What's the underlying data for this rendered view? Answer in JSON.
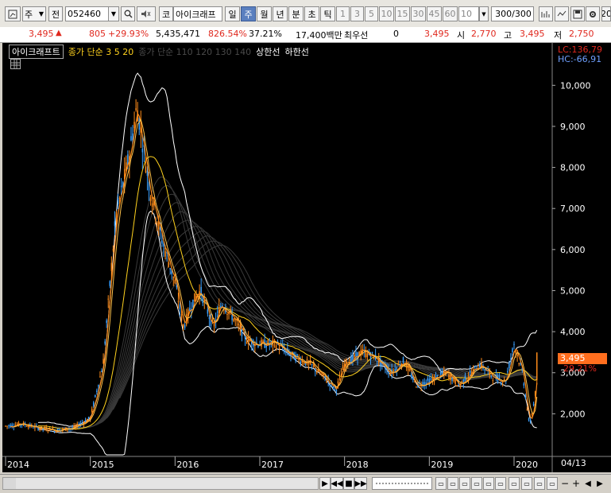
{
  "toolbar": {
    "market": "주",
    "type_label": "전",
    "code": "052460",
    "item_marker": "코",
    "item_name": "아이크래프",
    "period_tabs": [
      "일",
      "주",
      "월",
      "년"
    ],
    "active_period": "주",
    "minute_tabs": [
      "분",
      "초",
      "틱"
    ],
    "intervals": [
      "1",
      "3",
      "5",
      "10",
      "15",
      "30",
      "45",
      "60"
    ],
    "interval_value": "10",
    "count_value": "300/300",
    "right_edge": "20"
  },
  "quote": {
    "price": "3,495",
    "change": "805",
    "change_pct": "+29.93%",
    "volume": "5,435,471",
    "volume_ratio": "826.54%",
    "turnover": "37.21%",
    "amount": "17,400백만",
    "priority_label": "최우선",
    "priority_value": "0",
    "ask": "3,495",
    "open_label": "시",
    "open": "2,770",
    "high_label": "고",
    "high": "3,495",
    "low_label": "저",
    "low": "2,750"
  },
  "legend": {
    "name": "아이크래프트",
    "price_ma_label": "종가 단순 3  5  20",
    "price_ma_long": "종가 단순 110  120  130  140",
    "limit_up": "상한선",
    "limit_down": "하한선",
    "lc": "LC:136,79",
    "hc": "HC:-66,91"
  },
  "colors": {
    "up": "#e0281e",
    "down": "#3aa0ff",
    "price_line": "#ff8c1a",
    "ma_short": "#ffd21e",
    "background": "#000000"
  },
  "chart_data": {
    "type": "candlestick",
    "x_ticks": [
      "2014",
      "2015",
      "2016",
      "2017",
      "2018",
      "2019",
      "2020"
    ],
    "x_right_label": "04/13",
    "y_ticks": [
      "10,000",
      "9,000",
      "8,000",
      "7,000",
      "6,000",
      "5,000",
      "4,000",
      "3,000",
      "2,000"
    ],
    "y_tick_values": [
      10000,
      9000,
      8000,
      7000,
      6000,
      5000,
      4000,
      3000,
      2000
    ],
    "ylim": [
      1000,
      10800
    ],
    "last_price_label": "3,495",
    "last_change_label": "29.21%",
    "last_price": 3495,
    "close_series": [
      [
        2014.0,
        1700
      ],
      [
        2014.2,
        1750
      ],
      [
        2014.4,
        1650
      ],
      [
        2014.6,
        1600
      ],
      [
        2014.8,
        1650
      ],
      [
        2015.0,
        1900
      ],
      [
        2015.15,
        3200
      ],
      [
        2015.3,
        6800
      ],
      [
        2015.45,
        8200
      ],
      [
        2015.55,
        9500
      ],
      [
        2015.7,
        7500
      ],
      [
        2015.85,
        6200
      ],
      [
        2016.0,
        5200
      ],
      [
        2016.1,
        4100
      ],
      [
        2016.2,
        4700
      ],
      [
        2016.3,
        5000
      ],
      [
        2016.45,
        4100
      ],
      [
        2016.55,
        4700
      ],
      [
        2016.7,
        4300
      ],
      [
        2016.85,
        3800
      ],
      [
        2017.0,
        3700
      ],
      [
        2017.2,
        3700
      ],
      [
        2017.4,
        3400
      ],
      [
        2017.6,
        3200
      ],
      [
        2017.8,
        2800
      ],
      [
        2017.9,
        2600
      ],
      [
        2018.0,
        3200
      ],
      [
        2018.2,
        3500
      ],
      [
        2018.35,
        3400
      ],
      [
        2018.55,
        3000
      ],
      [
        2018.7,
        3300
      ],
      [
        2018.85,
        2700
      ],
      [
        2019.0,
        2800
      ],
      [
        2019.2,
        3000
      ],
      [
        2019.35,
        2700
      ],
      [
        2019.5,
        3000
      ],
      [
        2019.6,
        3200
      ],
      [
        2019.75,
        2900
      ],
      [
        2019.9,
        2800
      ],
      [
        2020.0,
        3700
      ],
      [
        2020.1,
        3000
      ],
      [
        2020.18,
        1700
      ],
      [
        2020.22,
        2100
      ],
      [
        2020.27,
        2750
      ],
      [
        2020.28,
        3495
      ]
    ]
  },
  "bottom": {
    "scroll_value": "100",
    "zoom_label": "−"
  }
}
